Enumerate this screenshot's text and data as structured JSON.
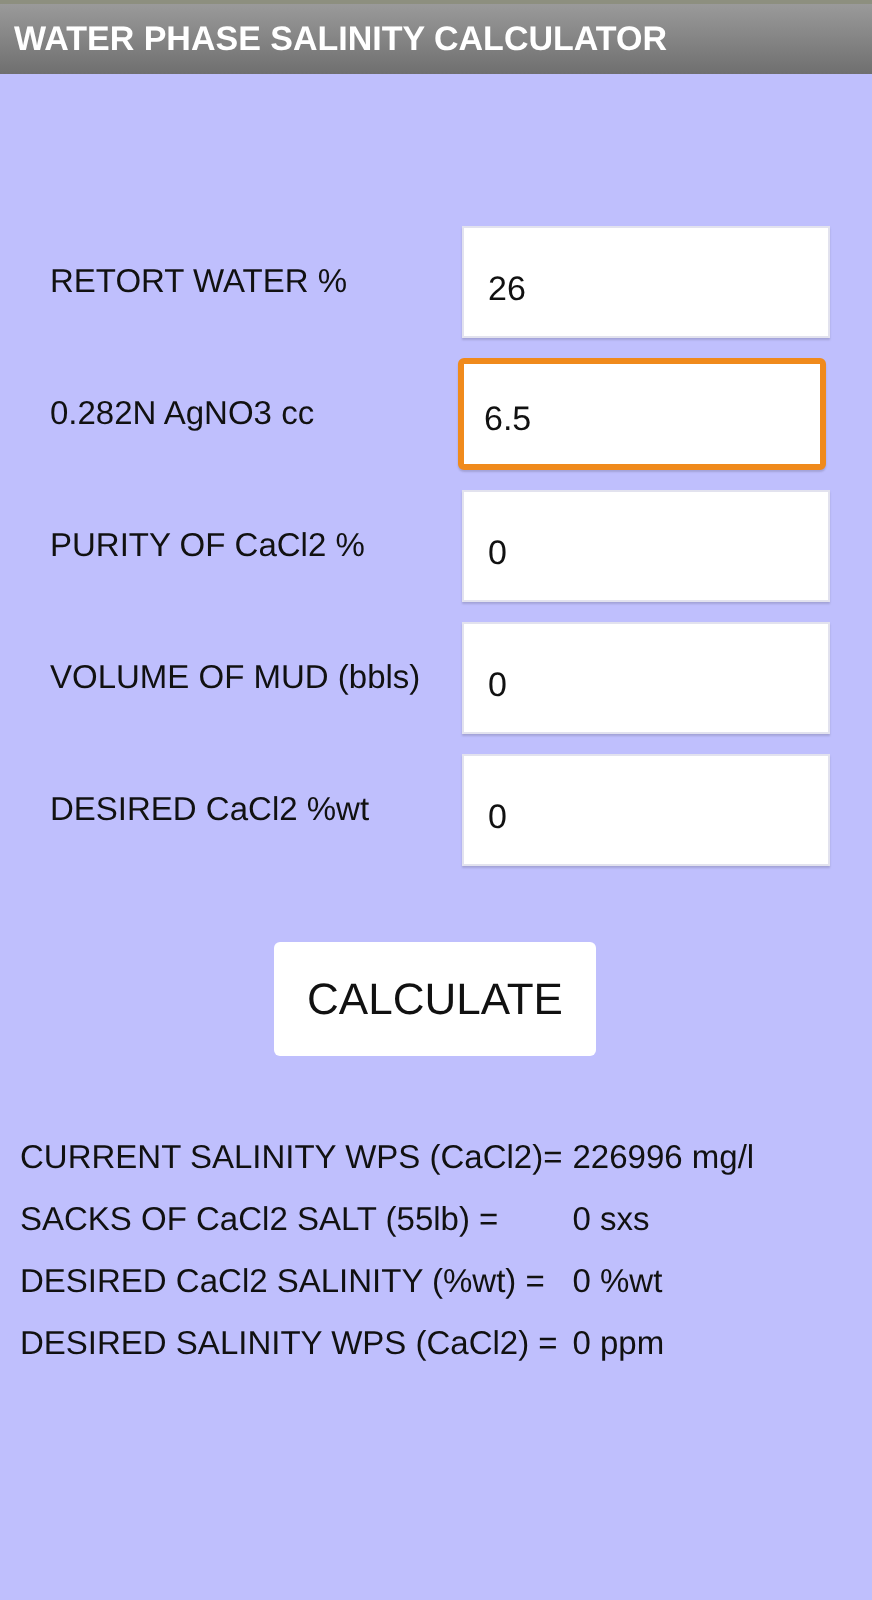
{
  "title_bar": {
    "title": "WATER PHASE SALINITY CALCULATOR"
  },
  "inputs": [
    {
      "label": "RETORT WATER %",
      "value": "26",
      "focused": false
    },
    {
      "label": "0.282N AgNO3 cc",
      "value": "6.5",
      "focused": true
    },
    {
      "label": "PURITY OF CaCl2 %",
      "value": "0",
      "focused": false
    },
    {
      "label": "VOLUME OF MUD (bbls)",
      "value": "0",
      "focused": false
    },
    {
      "label": "DESIRED CaCl2 %wt",
      "value": "0",
      "focused": false
    }
  ],
  "calculate_button": "CALCULATE",
  "results": [
    {
      "label": "CURRENT SALINITY WPS (CaCl2)=",
      "value": "226996 mg/l"
    },
    {
      "label": "SACKS OF CaCl2 SALT (55lb) =",
      "value": "0 sxs"
    },
    {
      "label": "DESIRED CaCl2 SALINITY (%wt) =",
      "value": "0 %wt"
    },
    {
      "label": "DESIRED SALINITY WPS (CaCl2) =",
      "value": "0 ppm"
    }
  ]
}
